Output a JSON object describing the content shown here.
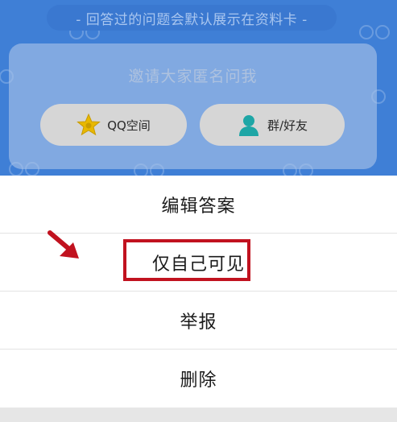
{
  "profile_card": {
    "notice": "- 回答过的问题会默认展示在资料卡 -",
    "invite_title": "邀请大家匿名问我",
    "buttons": [
      {
        "label": "QQ空间",
        "icon": "star-icon"
      },
      {
        "label": "群/好友",
        "icon": "person-icon"
      }
    ]
  },
  "action_sheet": {
    "items": [
      {
        "label": "编辑答案"
      },
      {
        "label": "仅自己可见",
        "highlighted": true
      },
      {
        "label": "举报"
      },
      {
        "label": "删除"
      }
    ]
  },
  "colors": {
    "header_blue": "#3f7fd6",
    "highlight_red": "#c1121f",
    "star_yellow": "#e8b800",
    "person_teal": "#1ea6a6"
  }
}
